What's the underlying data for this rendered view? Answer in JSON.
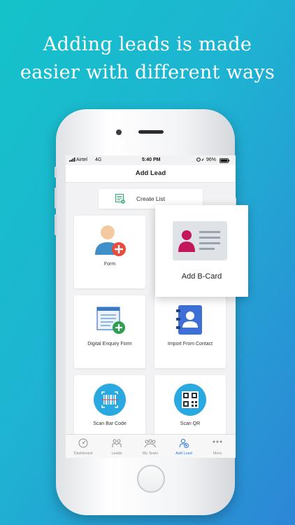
{
  "headline": {
    "line1": "Adding leads is made",
    "line2": "easier with different ways"
  },
  "status_bar": {
    "carrier": "Airtel",
    "network": "4G",
    "time": "5:40 PM",
    "battery": "96%"
  },
  "nav": {
    "title": "Add Lead"
  },
  "create_list": {
    "label": "Create List"
  },
  "cards": [
    {
      "label": "Form",
      "icon": "person-add-icon"
    },
    {
      "label": "Digital Enquiry Form",
      "icon": "form-add-icon"
    },
    {
      "label": "Import From Contact",
      "icon": "contact-book-icon"
    },
    {
      "label": "Scan Bar Code",
      "icon": "barcode-icon"
    },
    {
      "label": "Scan QR",
      "icon": "qr-code-icon"
    }
  ],
  "popup": {
    "label": "Add B-Card",
    "icon": "business-card-icon"
  },
  "tabs": [
    {
      "label": "Dashboard",
      "icon": "dashboard-icon"
    },
    {
      "label": "Leads",
      "icon": "leads-icon"
    },
    {
      "label": "My Team",
      "icon": "team-icon"
    },
    {
      "label": "Add Lead",
      "icon": "add-lead-icon",
      "active": true
    },
    {
      "label": "More",
      "icon": "more-icon"
    }
  ],
  "colors": {
    "accent": "#2d7be0",
    "bg_start": "#14c3c9",
    "bg_end": "#2d86d6"
  }
}
